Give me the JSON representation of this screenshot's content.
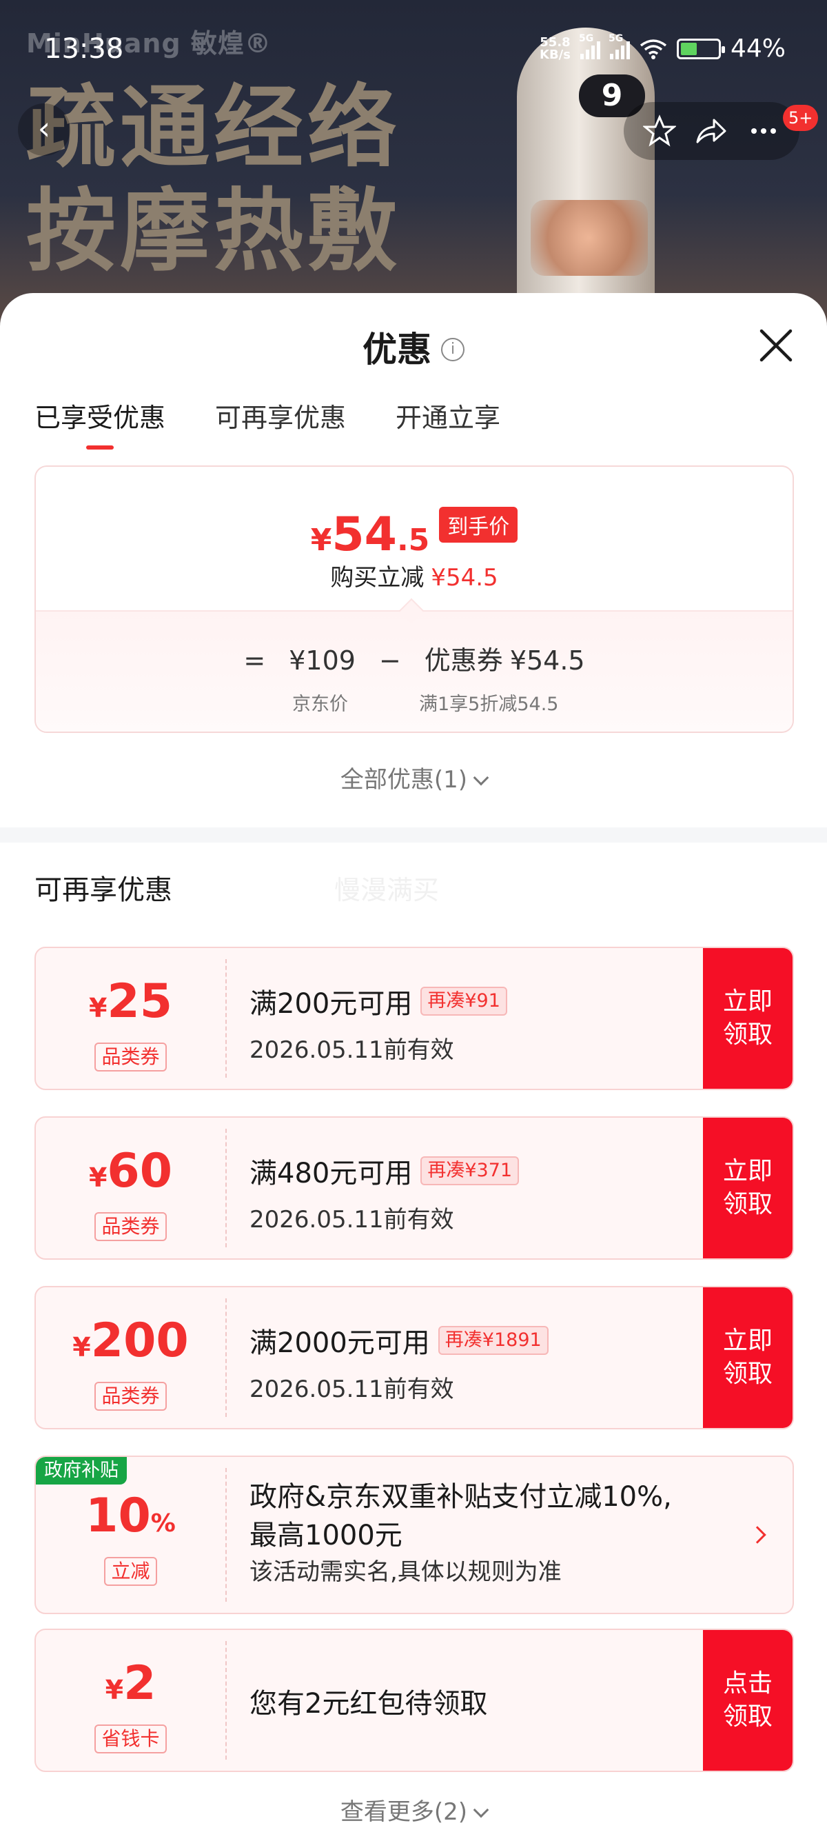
{
  "status_bar": {
    "time": "13:38",
    "net_speed_top": "55.8",
    "net_speed_unit": "KB/s",
    "sim1_tag": "5G",
    "sim2_tag": "5G",
    "battery_pct": "44%"
  },
  "background": {
    "brand_logo": "MinHuang 敏煌®",
    "headline_line1": "疏通经络",
    "headline_line2": "按摩热敷",
    "device_display": "9",
    "nav_badge": "5+",
    "icons": [
      "back-icon",
      "star-icon",
      "share-icon",
      "more-icon"
    ]
  },
  "sheet": {
    "title": "优惠",
    "tabs": [
      "已享受优惠",
      "可再享优惠",
      "开通立享"
    ],
    "active_tab": 0,
    "summary": {
      "yen": "¥",
      "price_int": "54",
      "price_dec": ".5",
      "price_tag": "到手价",
      "direct_label": "购买立减",
      "direct_value": "¥54.5",
      "eq": "=",
      "jd_price": "¥109",
      "minus": "−",
      "coupon_label": "优惠券",
      "coupon_value": "¥54.5",
      "jd_price_label": "京东价",
      "coupon_desc": "满1享5折减54.5"
    },
    "all_offers": "全部优惠(1)",
    "section_title": "可再享优惠",
    "ghost_text": "慢漫满买",
    "coupons": [
      {
        "yen": "¥",
        "amount": "25",
        "kind": "品类券",
        "condition": "满200元可用",
        "need": "再凑¥91",
        "valid": "2026.05.11前有效",
        "action": "立即领取"
      },
      {
        "yen": "¥",
        "amount": "60",
        "kind": "品类券",
        "condition": "满480元可用",
        "need": "再凑¥371",
        "valid": "2026.05.11前有效",
        "action": "立即领取"
      },
      {
        "yen": "¥",
        "amount": "200",
        "kind": "品类券",
        "condition": "满2000元可用",
        "need": "再凑¥1891",
        "valid": "2026.05.11前有效",
        "action": "立即领取"
      }
    ],
    "gov_coupon": {
      "badge": "政府补贴",
      "amount": "10",
      "pct": "%",
      "kind": "立减",
      "line1": "政府&京东双重补贴支付立减10%,",
      "line2": "最高1000元",
      "sub": "该活动需实名,具体以规则为准"
    },
    "redpacket": {
      "yen": "¥",
      "amount": "2",
      "kind": "省钱卡",
      "text": "您有2元红包待领取",
      "action": "点击领取"
    },
    "view_more": "查看更多(2)"
  },
  "colors": {
    "accent_red": "#f2302f",
    "action_red": "#f50f26",
    "gov_green": "#17a545"
  }
}
